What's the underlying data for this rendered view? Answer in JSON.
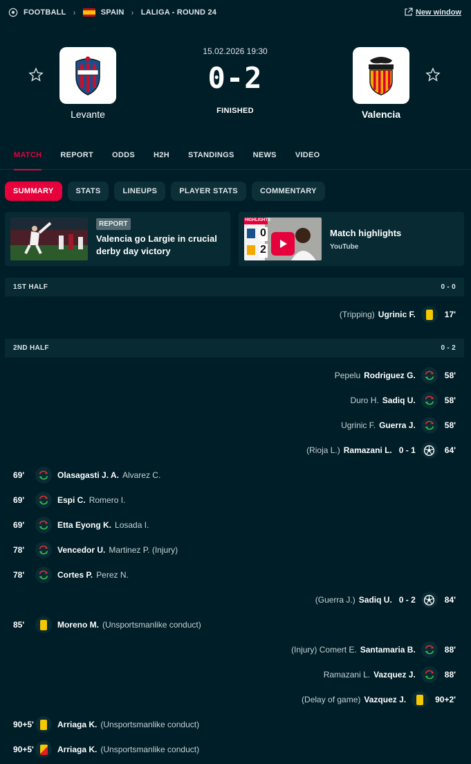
{
  "breadcrumb": {
    "sport": "FOOTBALL",
    "country": "SPAIN",
    "competition": "LALIGA - ROUND 24",
    "new_window": "New window"
  },
  "match": {
    "datetime": "15.02.2026 19:30",
    "home_score": "0",
    "score_sep": "-",
    "away_score": "2",
    "status": "FINISHED",
    "home_team": "Levante",
    "away_team": "Valencia",
    "home_color": "#17508c",
    "home_accent": "#c8102e",
    "away_color": "#f5a800",
    "away_accent": "#d50032"
  },
  "tabs": [
    "MATCH",
    "REPORT",
    "ODDS",
    "H2H",
    "STANDINGS",
    "NEWS",
    "VIDEO"
  ],
  "subtabs": [
    "SUMMARY",
    "STATS",
    "LINEUPS",
    "PLAYER STATS",
    "COMMENTARY"
  ],
  "report_card": {
    "badge": "REPORT",
    "title_line1": "Valencia go Largie in crucial",
    "title_line2": "derby day victory"
  },
  "video_card": {
    "title": "Match highlights",
    "source": "YouTube",
    "thumb_label": "HIGHLIGHTS",
    "thumb_home": "0",
    "thumb_away": "2"
  },
  "halves": [
    {
      "label": "1ST HALF",
      "score": "0 - 0"
    },
    {
      "label": "2ND HALF",
      "score": "0 - 2"
    }
  ],
  "incidents": [
    {
      "side": "away",
      "type": "yellow",
      "minute": "17'",
      "player": "Ugrinic F.",
      "detail": "(Tripping)"
    },
    {
      "side": "away",
      "type": "sub",
      "minute": "58'",
      "player": "Rodriguez G.",
      "detail": "Pepelu"
    },
    {
      "side": "away",
      "type": "sub",
      "minute": "58'",
      "player": "Sadiq U.",
      "detail": "Duro H."
    },
    {
      "side": "away",
      "type": "sub",
      "minute": "58'",
      "player": "Guerra J.",
      "detail": "Ugrinic F."
    },
    {
      "side": "away",
      "type": "goal",
      "minute": "64'",
      "player": "Ramazani L.",
      "detail": "(Rioja L.)",
      "score": "0 - 1"
    },
    {
      "side": "home",
      "type": "sub",
      "minute": "69'",
      "player": "Olasagasti J. A.",
      "detail": "Alvarez C."
    },
    {
      "side": "home",
      "type": "sub",
      "minute": "69'",
      "player": "Espi C.",
      "detail": "Romero I."
    },
    {
      "side": "home",
      "type": "sub",
      "minute": "69'",
      "player": "Etta Eyong K.",
      "detail": "Losada I."
    },
    {
      "side": "home",
      "type": "sub",
      "minute": "78'",
      "player": "Vencedor U.",
      "detail": "Martinez P. (Injury)"
    },
    {
      "side": "home",
      "type": "sub",
      "minute": "78'",
      "player": "Cortes P.",
      "detail": "Perez N."
    },
    {
      "side": "away",
      "type": "goal",
      "minute": "84'",
      "player": "Sadiq U.",
      "detail": "(Guerra J.)",
      "score": "0 - 2"
    },
    {
      "side": "home",
      "type": "yellow",
      "minute": "85'",
      "player": "Moreno M.",
      "detail": "(Unsportsmanlike conduct)"
    },
    {
      "side": "away",
      "type": "sub",
      "minute": "88'",
      "player": "Santamaria B.",
      "detail": "(Injury) Comert E."
    },
    {
      "side": "away",
      "type": "sub",
      "minute": "88'",
      "player": "Vazquez J.",
      "detail": "Ramazani L."
    },
    {
      "side": "away",
      "type": "yellow",
      "minute": "90+2'",
      "player": "Vazquez J.",
      "detail": "(Delay of game)"
    },
    {
      "side": "home",
      "type": "yellow",
      "minute": "90+5'",
      "player": "Arriaga K.",
      "detail": "(Unsportsmanlike conduct)"
    },
    {
      "side": "home",
      "type": "yellow-red",
      "minute": "90+5'",
      "player": "Arriaga K.",
      "detail": "(Unsportsmanlike conduct)"
    }
  ],
  "colors": {
    "background": "#001e28",
    "panel": "#072a33",
    "accent": "#e6003c",
    "yellow_card": "#f5c800",
    "sub_in": "#2fc44a",
    "sub_out": "#e62e2e"
  }
}
